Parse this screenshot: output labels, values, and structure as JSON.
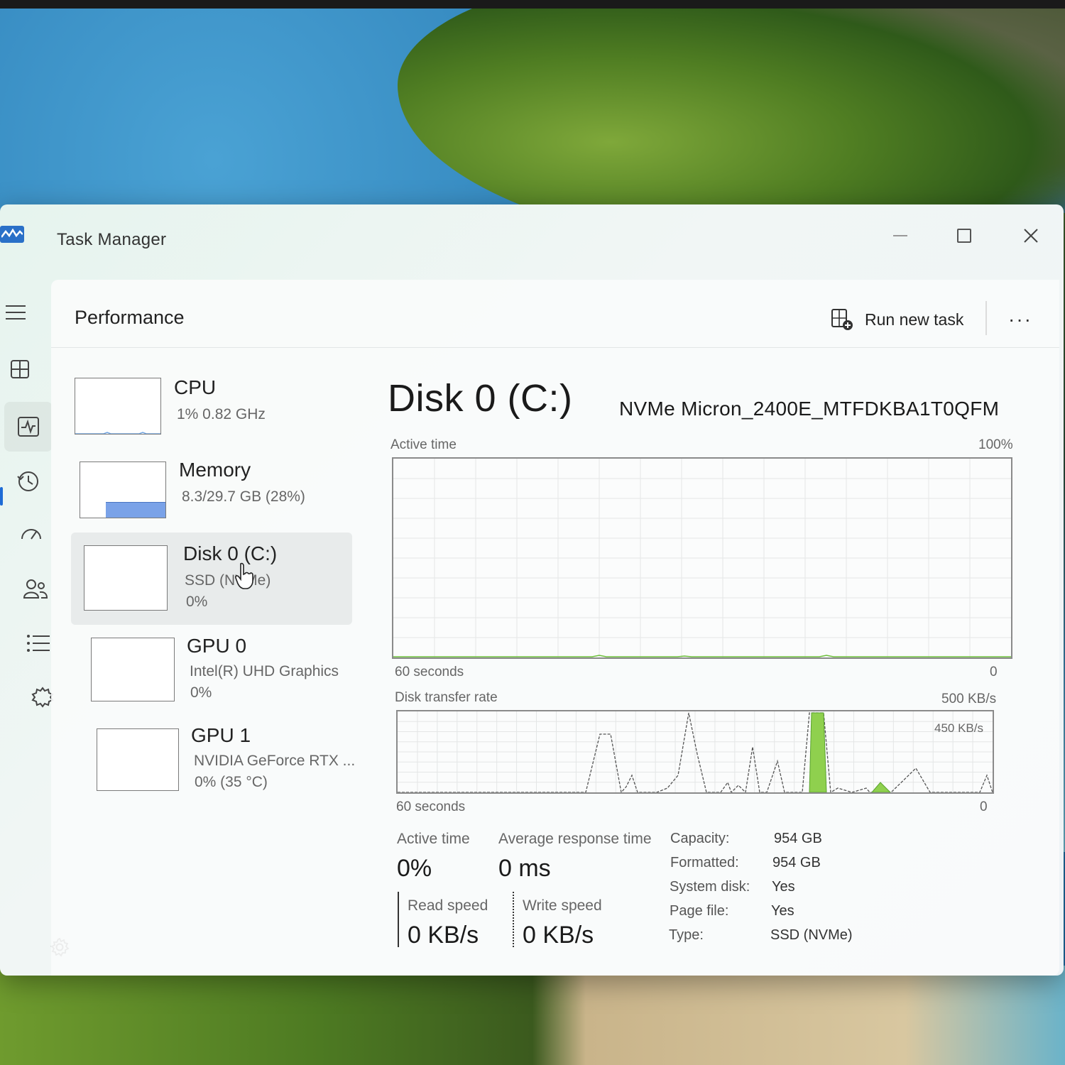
{
  "window": {
    "title": "Task Manager"
  },
  "header": {
    "title": "Performance",
    "run_new_task": "Run new task",
    "more": "···"
  },
  "devices": [
    {
      "name": "CPU",
      "line1": "1%  0.82 GHz",
      "line2": ""
    },
    {
      "name": "Memory",
      "line1": "8.3/29.7 GB (28%)",
      "line2": ""
    },
    {
      "name": "Disk 0 (C:)",
      "line1": "SSD (NVMe)",
      "line2": "0%"
    },
    {
      "name": "GPU 0",
      "line1": "Intel(R) UHD Graphics",
      "line2": "0%"
    },
    {
      "name": "GPU 1",
      "line1": "NVIDIA GeForce RTX ...",
      "line2": "0%  (35 °C)"
    }
  ],
  "memory_usage_fraction": 0.28,
  "detail": {
    "title": "Disk 0 (C:)",
    "model": "NVMe Micron_2400E_MTFDKBA1T0QFM",
    "active_graph": {
      "label": "Active time",
      "max_label": "100%",
      "time_label": "60 seconds",
      "zero_label": "0"
    },
    "transfer_graph": {
      "label": "Disk transfer rate",
      "max_label": "500 KB/s",
      "line_label": "450 KB/s",
      "time_label": "60 seconds",
      "zero_label": "0"
    },
    "stats": {
      "active_time_label": "Active time",
      "active_time_value": "0%",
      "response_label": "Average response time",
      "response_value": "0 ms",
      "read_label": "Read speed",
      "read_value": "0 KB/s",
      "write_label": "Write speed",
      "write_value": "0 KB/s"
    },
    "properties": [
      {
        "key": "Capacity:",
        "value": "954 GB"
      },
      {
        "key": "Formatted:",
        "value": "954 GB"
      },
      {
        "key": "System disk:",
        "value": "Yes"
      },
      {
        "key": "Page file:",
        "value": "Yes"
      },
      {
        "key": "Type:",
        "value": "SSD (NVMe)"
      }
    ]
  },
  "nav_icons": [
    "hamburger-icon",
    "processes-icon",
    "performance-icon",
    "app-history-icon",
    "startup-apps-icon",
    "users-icon",
    "details-icon",
    "services-icon",
    "settings-icon"
  ],
  "colors": {
    "accent": "#1e6bd6",
    "disk_graph": "#6cbf3a",
    "memory_fill": "#7aa2e8"
  }
}
